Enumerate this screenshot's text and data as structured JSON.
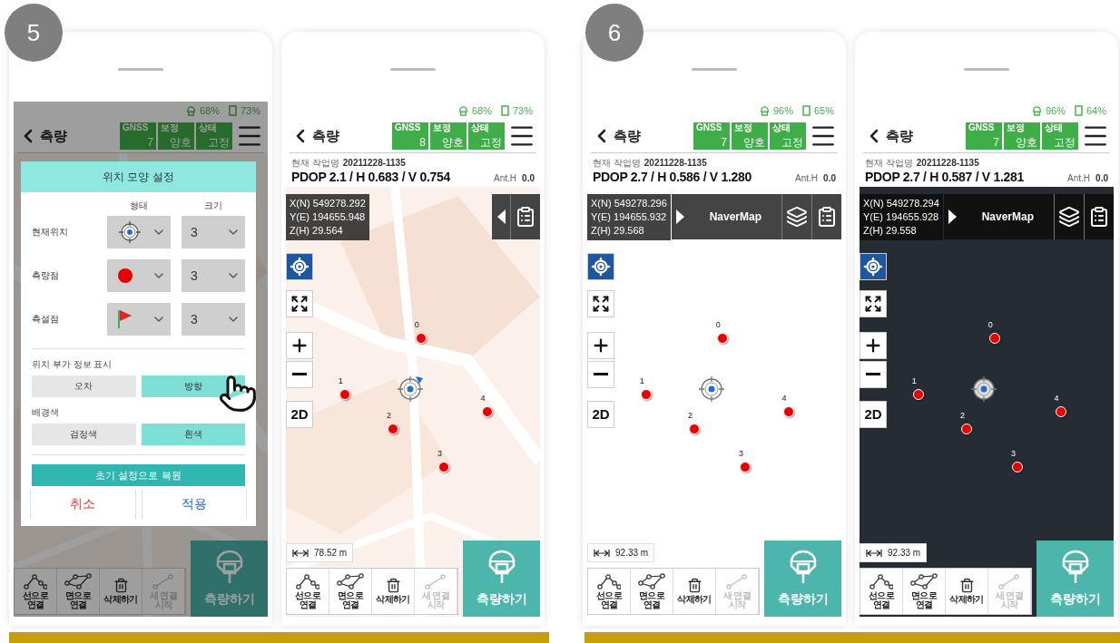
{
  "steps": [
    {
      "number": "5",
      "phones": [
        {
          "status": {
            "gnss": "68%",
            "battery": "73%"
          },
          "header": {
            "title": "측량",
            "stats": [
              {
                "label": "GNSS",
                "value": "7"
              },
              {
                "label": "보정",
                "value": "양호"
              },
              {
                "label": "상태",
                "value": "고정"
              }
            ]
          },
          "map": {
            "kind": "map"
          },
          "toolbar": [
            {
              "label": "선으로 연결",
              "kind": "line",
              "disabled": false
            },
            {
              "label": "면으로 연결",
              "kind": "polygon",
              "disabled": false
            },
            {
              "label": "삭제하기",
              "kind": "delete",
              "disabled": false
            },
            {
              "label": "새 연결 시작",
              "kind": "new",
              "disabled": true
            }
          ],
          "measure_button": "측량하기",
          "dialog": {
            "title": "위치 모양 설정",
            "columns": [
              "형태",
              "크기"
            ],
            "rows": [
              {
                "label": "현재위치",
                "kind": "crosshair",
                "size": "3"
              },
              {
                "label": "측량점",
                "kind": "dot",
                "size": "3"
              },
              {
                "label": "측설점",
                "kind": "flag",
                "size": "3"
              }
            ],
            "options": [
              {
                "title": "위치 부가 정보 표시",
                "choices": [
                  {
                    "label": "오차",
                    "selected": false,
                    "tapped": false
                  },
                  {
                    "label": "방향",
                    "selected": true,
                    "tapped": true
                  }
                ]
              },
              {
                "title": "배경색",
                "choices": [
                  {
                    "label": "검정색",
                    "selected": false,
                    "tapped": false
                  },
                  {
                    "label": "흰색",
                    "selected": true,
                    "tapped": false
                  }
                ]
              }
            ],
            "reset_button": "초기 설정으로 복원",
            "cancel_button": "취소",
            "apply_button": "적용"
          }
        },
        {
          "status": {
            "gnss": "68%",
            "battery": "73%"
          },
          "header": {
            "title": "측량",
            "stats": [
              {
                "label": "GNSS",
                "value": "8"
              },
              {
                "label": "보정",
                "value": "양호"
              },
              {
                "label": "상태",
                "value": "고정"
              }
            ]
          },
          "job": {
            "label": "현재 작업명",
            "value": "20211228-1135"
          },
          "precision": "PDOP 2.1 / H 0.683 / V 0.754",
          "antenna": {
            "label": "Ant.H",
            "value": "0.0"
          },
          "map": {
            "kind": "map",
            "coordinates": [
              "X(N) 549278.292",
              "Y(E) 194655.948",
              "Z(H) 29.564"
            ],
            "layer_panel": {
              "expanded": false
            },
            "view_mode": "2D",
            "points": [
              "0",
              "1",
              "2",
              "3",
              "4"
            ],
            "position_marker": {
              "heading": true
            },
            "scale": "78.52 m"
          },
          "toolbar": [
            {
              "label": "선으로 연결",
              "kind": "line",
              "disabled": false
            },
            {
              "label": "면으로 연결",
              "kind": "polygon",
              "disabled": false
            },
            {
              "label": "삭제하기",
              "kind": "delete",
              "disabled": false
            },
            {
              "label": "새 연결 시작",
              "kind": "new",
              "disabled": true
            }
          ],
          "measure_button": "측량하기"
        }
      ]
    },
    {
      "number": "6",
      "phones": [
        {
          "status": {
            "gnss": "96%",
            "battery": "65%"
          },
          "header": {
            "title": "측량",
            "stats": [
              {
                "label": "GNSS",
                "value": "7"
              },
              {
                "label": "보정",
                "value": "양호"
              },
              {
                "label": "상태",
                "value": "고정"
              }
            ]
          },
          "job": {
            "label": "현재 작업명",
            "value": "20211228-1135"
          },
          "precision": "PDOP 2.7 / H 0.586 / V 1.280",
          "antenna": {
            "label": "Ant.H",
            "value": "0.0"
          },
          "map": {
            "kind": "white",
            "coordinates": [
              "X(N) 549278.296",
              "Y(E) 194655.932",
              "Z(H) 29.568"
            ],
            "layer_panel": {
              "expanded": true,
              "label": "NaverMap"
            },
            "view_mode": "2D",
            "points": [
              "0",
              "1",
              "2",
              "3",
              "4"
            ],
            "position_marker": {
              "heading": false
            },
            "scale": "92.33 m"
          },
          "toolbar": [
            {
              "label": "선으로 연결",
              "kind": "line",
              "disabled": false
            },
            {
              "label": "면으로 연결",
              "kind": "polygon",
              "disabled": false
            },
            {
              "label": "삭제하기",
              "kind": "delete",
              "disabled": false
            },
            {
              "label": "새 연결 시작",
              "kind": "new",
              "disabled": true
            }
          ],
          "measure_button": "측량하기"
        },
        {
          "status": {
            "gnss": "96%",
            "battery": "64%"
          },
          "header": {
            "title": "측량",
            "stats": [
              {
                "label": "GNSS",
                "value": "7"
              },
              {
                "label": "보정",
                "value": "양호"
              },
              {
                "label": "상태",
                "value": "고정"
              }
            ]
          },
          "job": {
            "label": "현재 작업명",
            "value": "20211228-1135"
          },
          "precision": "PDOP 2.7 / H 0.587 / V 1.281",
          "antenna": {
            "label": "Ant.H",
            "value": "0.0"
          },
          "map": {
            "kind": "dark",
            "coordinates": [
              "X(N) 549278.294",
              "Y(E) 194655.928",
              "Z(H) 29.558"
            ],
            "layer_panel": {
              "expanded": true,
              "label": "NaverMap"
            },
            "view_mode": "2D",
            "points": [
              "0",
              "1",
              "2",
              "3",
              "4"
            ],
            "position_marker": {
              "heading": false
            },
            "scale": "92.33 m"
          },
          "toolbar": [
            {
              "label": "선으로 연결",
              "kind": "line",
              "disabled": false
            },
            {
              "label": "면으로 연결",
              "kind": "polygon",
              "disabled": false
            },
            {
              "label": "삭제하기",
              "kind": "delete",
              "disabled": false
            },
            {
              "label": "새 연결 시작",
              "kind": "new",
              "disabled": true
            }
          ],
          "measure_button": "측량하기"
        }
      ]
    }
  ]
}
